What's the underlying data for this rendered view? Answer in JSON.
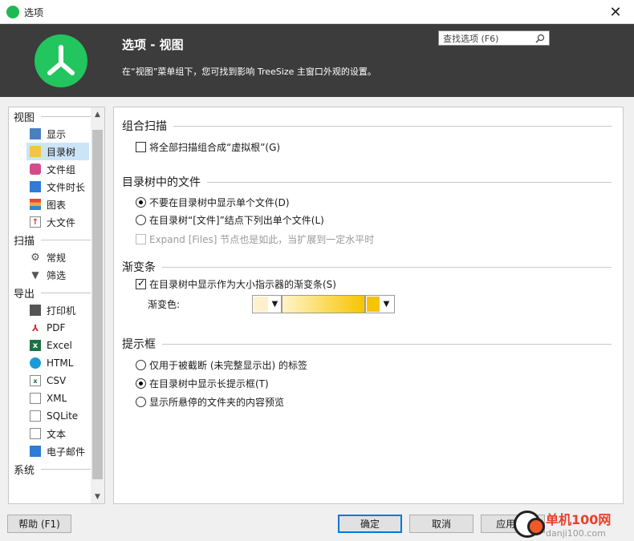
{
  "window": {
    "title": "选项",
    "close": "✕"
  },
  "header": {
    "title": "选项 - 视图",
    "subtitle": "在“视图”菜单组下，您可找到影响 TreeSize 主窗口外观的设置。",
    "search_placeholder": "查找选项 (F6)"
  },
  "nav": {
    "sections": [
      {
        "label": "视图",
        "items": [
          {
            "label": "显示",
            "icon": "monitor-icon"
          },
          {
            "label": "目录树",
            "icon": "tree-icon",
            "selected": true
          },
          {
            "label": "文件组",
            "icon": "file-group-icon"
          },
          {
            "label": "文件时长",
            "icon": "calendar-icon"
          },
          {
            "label": "图表",
            "icon": "chart-icon"
          },
          {
            "label": "大文件",
            "icon": "big-file-icon"
          }
        ]
      },
      {
        "label": "扫描",
        "items": [
          {
            "label": "常规",
            "icon": "gear-icon"
          },
          {
            "label": "筛选",
            "icon": "filter-icon"
          }
        ]
      },
      {
        "label": "导出",
        "items": [
          {
            "label": "打印机",
            "icon": "printer-icon"
          },
          {
            "label": "PDF",
            "icon": "pdf-icon"
          },
          {
            "label": "Excel",
            "icon": "excel-icon"
          },
          {
            "label": "HTML",
            "icon": "html-icon"
          },
          {
            "label": "CSV",
            "icon": "csv-icon"
          },
          {
            "label": "XML",
            "icon": "xml-icon"
          },
          {
            "label": "SQLite",
            "icon": "sqlite-icon"
          },
          {
            "label": "文本",
            "icon": "text-icon"
          },
          {
            "label": "电子邮件",
            "icon": "email-icon"
          }
        ]
      },
      {
        "label": "系统",
        "items": []
      }
    ]
  },
  "groups": {
    "combine": {
      "title": "组合扫描",
      "option": {
        "label": "将全部扫描组合成“虚拟根”(G)",
        "checked": false
      }
    },
    "files": {
      "title": "目录树中的文件",
      "radio1": "不要在目录树中显示单个文件(D)",
      "radio2": "在目录树“[文件]”结点下列出单个文件(L)",
      "sub_option": "Expand [Files] 节点也是如此，当扩展到一定水平时",
      "selected": 1
    },
    "gradient": {
      "title": "渐变条",
      "option": "在目录树中显示作为大小指示器的渐变条(S)",
      "checked": true,
      "color_label": "渐变色:",
      "color_start": "#fff1cc",
      "color_end": "#f6c400"
    },
    "tooltip": {
      "title": "提示框",
      "radio1": "仅用于被截断 (未完整显示出) 的标签",
      "radio2": "在目录树中显示长提示框(T)",
      "radio3": "显示所悬停的文件夹的内容预览",
      "selected": 2
    }
  },
  "buttons": {
    "help": "帮助 (F1)",
    "ok": "确定",
    "cancel": "取消",
    "apply": "应用(A)"
  },
  "watermark": {
    "line1": "单机100网",
    "line2": "danji100.com"
  }
}
